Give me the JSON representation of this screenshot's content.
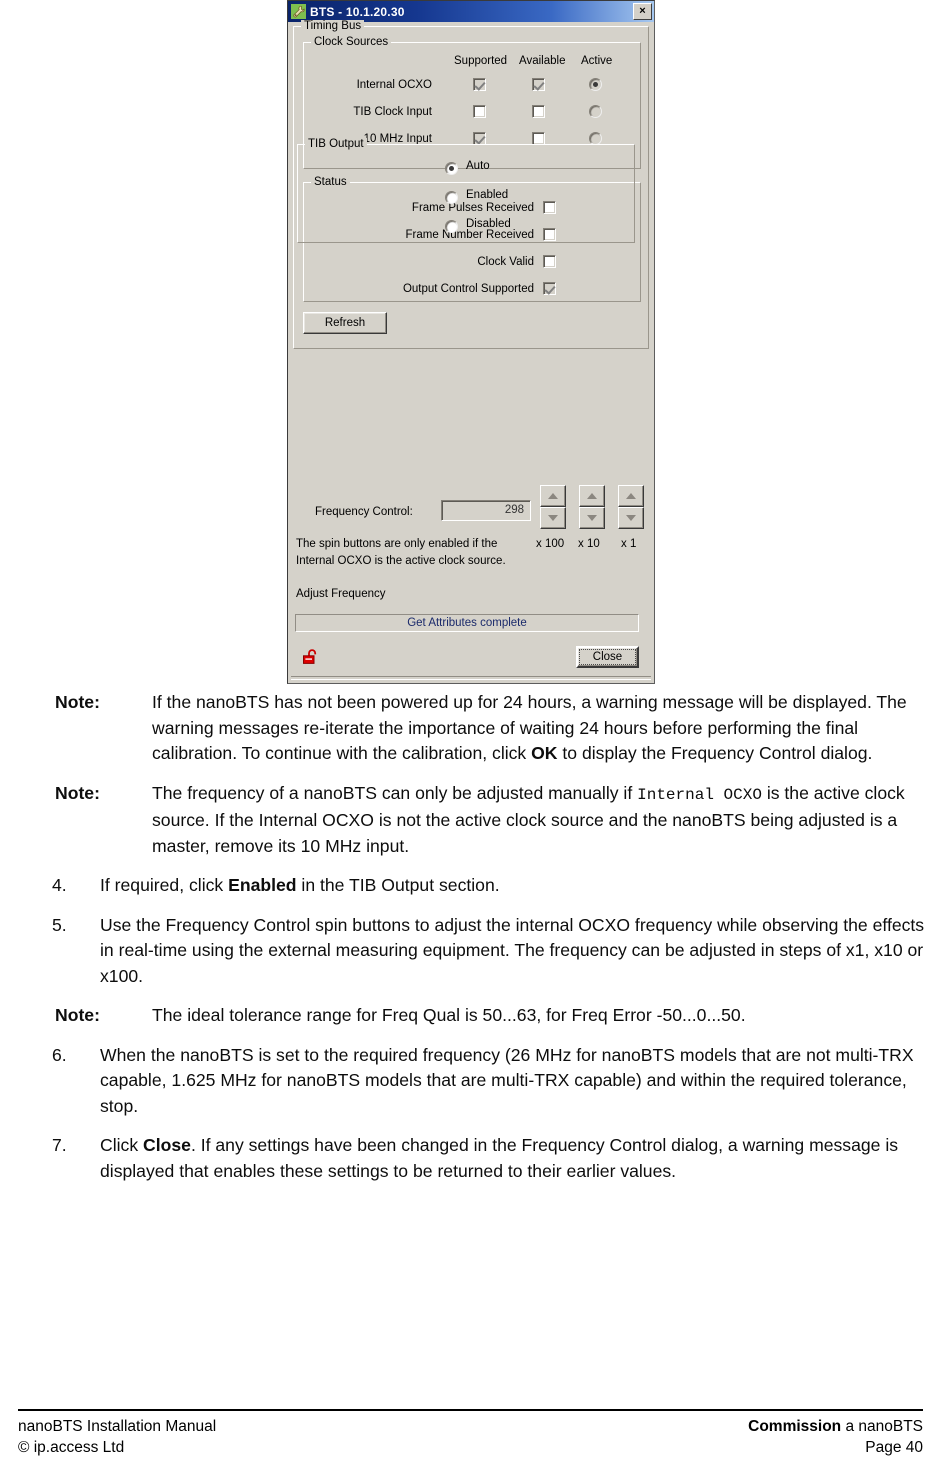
{
  "dialog": {
    "title": "BTS - 10.1.20.30",
    "title_icon": "wrench-icon",
    "close_button": "×",
    "timing_bus_label": "Timing Bus",
    "clock_sources": {
      "label": "Clock Sources",
      "columns": [
        "Supported",
        "Available",
        "Active"
      ],
      "rows": [
        {
          "label": "Internal OCXO",
          "supported": true,
          "available": true,
          "active": true
        },
        {
          "label": "TIB Clock Input",
          "supported": false,
          "available": false,
          "active": false
        },
        {
          "label": "10 MHz Input",
          "supported": true,
          "available": false,
          "active": false
        }
      ]
    },
    "status": {
      "label": "Status",
      "rows": [
        {
          "label": "Frame Pulses Received",
          "checked": false
        },
        {
          "label": "Frame Number Received",
          "checked": false
        },
        {
          "label": "Clock Valid",
          "checked": false
        },
        {
          "label": "Output Control Supported",
          "checked": true
        }
      ]
    },
    "refresh_button": "Refresh",
    "tib_output": {
      "label": "TIB Output",
      "options": [
        {
          "label": "Auto",
          "selected": true
        },
        {
          "label": "Enabled",
          "selected": false
        },
        {
          "label": "Disabled",
          "selected": false
        }
      ]
    },
    "frequency_control": {
      "label": "Frequency Control:",
      "value": "298",
      "multipliers": [
        "x 100",
        "x 10",
        "x 1"
      ]
    },
    "hint_line_1": "The spin buttons are only enabled if the",
    "hint_line_2": "Internal OCXO is the active clock source.",
    "adjust_frequency_label": "Adjust Frequency",
    "status_bar_text": "Get Attributes complete",
    "lock_icon": "unlocked-padlock-icon",
    "lock_color": "#cc0000",
    "close_label": "Close"
  },
  "document": {
    "paragraphs": [
      {
        "kind": "note",
        "marker": "Note:",
        "text": "If the nanoBTS has not been powered up for 24 hours, a warning message will be displayed. The warning messages re-iterate the importance of waiting 24 hours before performing the final calibration. To continue with the calibration, click OK to display the Frequency Control dialog."
      },
      {
        "kind": "note",
        "marker": "Note:",
        "text": "The frequency of a nanoBTS can only be adjusted manually if Internal OCXO is the active clock source. If the Internal OCXO is not the active clock source and the nanoBTS being adjusted is a master, remove its 10 MHz input."
      },
      {
        "kind": "num",
        "marker": "4.",
        "text": "If required, click Enabled in the TIB Output section."
      },
      {
        "kind": "num",
        "marker": "5.",
        "text": "Use the Frequency Control spin buttons to adjust the internal OCXO frequency while observing the effects in real-time using the external measuring equipment. The frequency can be adjusted in steps of x1, x10 or x100."
      },
      {
        "kind": "note",
        "marker": "Note:",
        "text": "The ideal tolerance range for Freq Qual is 50...63, for Freq Error -50...0...50."
      },
      {
        "kind": "num",
        "marker": "6.",
        "text": "When the nanoBTS is set to the required frequency (26 MHz for nanoBTS models that are not multi-TRX capable, 1.625 MHz for nanoBTS models that are multi-TRX capable) and within the required tolerance, stop."
      },
      {
        "kind": "num",
        "marker": "7.",
        "text": "Click Close. If any settings have been changed in the Frequency Control dialog, a warning message is displayed that enables these settings to be returned to their earlier values."
      }
    ]
  },
  "footer": {
    "left_line1": "nanoBTS Installation Manual",
    "left_line2": "© ip.access Ltd",
    "right_line1_bold": "Commission",
    "right_line1_rest": " a nanoBTS",
    "right_line2": "Page 40"
  }
}
